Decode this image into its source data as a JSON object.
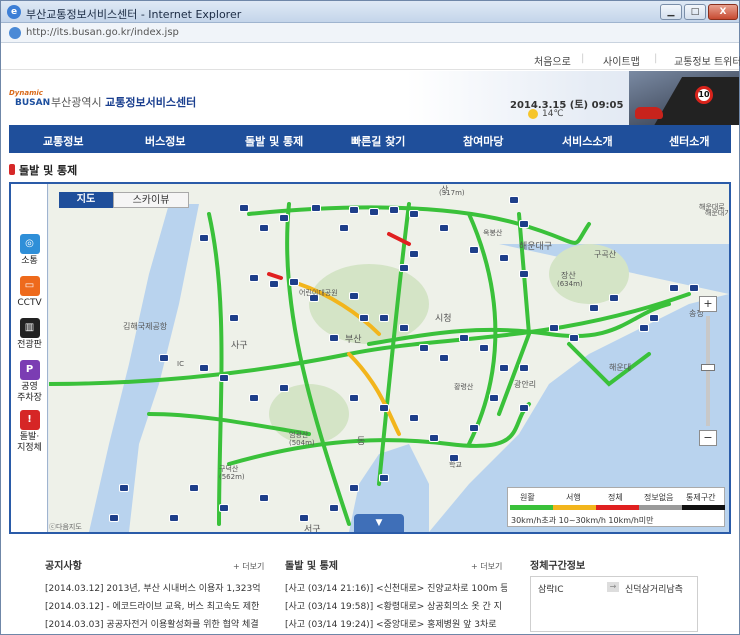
{
  "window": {
    "title": "부산교통정보서비스센터 - Internet Explorer",
    "url": "http://its.busan.go.kr/index.jsp",
    "min_label": "▁",
    "max_label": "□",
    "close_label": "X"
  },
  "topnav": {
    "home": "처음으로",
    "sitemap": "사이트맵",
    "twitter": "교통정보 트위터"
  },
  "header": {
    "logo_top": "Dynamic",
    "logo_bottom": "BUSAN",
    "city": "부산광역시",
    "center": "교통정보서비스센터",
    "datetime": "2014.3.15 (토) 09:05",
    "temperature": "14℃",
    "speed_sign": "10"
  },
  "mainnav": [
    "교통정보",
    "버스정보",
    "돌발 및 통제",
    "빠른길 찾기",
    "참여마당",
    "서비스소개",
    "센터소개"
  ],
  "section_title": "돌발 및 통제",
  "side_menu": [
    {
      "label": "소통",
      "color": "#2f8fd8",
      "icon": "traffic-icon"
    },
    {
      "label": "CCTV",
      "color": "#ee6a1c",
      "icon": "cctv-icon"
    },
    {
      "label": "전광판",
      "color": "#222222",
      "icon": "sign-board-icon"
    },
    {
      "label": "공영\n주차장",
      "color": "#7b3db3",
      "icon": "parking-icon"
    },
    {
      "label": "돌발·\n지정체",
      "color": "#d62626",
      "icon": "incident-icon"
    }
  ],
  "map": {
    "tab_map": "지도",
    "tab_skyview": "스카이뷰",
    "zoom_in": "+",
    "zoom_out": "−",
    "collapse": "▼",
    "copyright": "ⓒ다음지도",
    "labels": [
      {
        "text": "해운대구",
        "size": 9
      },
      {
        "text": "구곡산",
        "size": 8
      },
      {
        "text": "장산",
        "size": 8
      },
      {
        "text": "(634m)",
        "size": 7
      },
      {
        "text": "해운대",
        "size": 8
      },
      {
        "text": "어린이대공원",
        "size": 7
      },
      {
        "text": "부산",
        "size": 9
      },
      {
        "text": "시청",
        "size": 9
      },
      {
        "text": "김해국제공항",
        "size": 8
      },
      {
        "text": "사구",
        "size": 9
      },
      {
        "text": "엄광산",
        "size": 7
      },
      {
        "text": "(504m)",
        "size": 7
      },
      {
        "text": "구덕산",
        "size": 7
      },
      {
        "text": "(562m)",
        "size": 7
      },
      {
        "text": "광안리",
        "size": 8
      },
      {
        "text": "황령산",
        "size": 7
      },
      {
        "text": "동",
        "size": 9
      },
      {
        "text": "학교",
        "size": 7
      },
      {
        "text": "서구",
        "size": 9
      },
      {
        "text": "해운대로",
        "size": 7
      },
      {
        "text": "옥봉산",
        "size": 7
      },
      {
        "text": "산",
        "size": 8
      },
      {
        "text": "(317m)",
        "size": 7
      },
      {
        "text": "송정",
        "size": 8
      },
      {
        "text": "해운대기업",
        "size": 7
      },
      {
        "text": "IC",
        "size": 7
      }
    ],
    "legend": {
      "items": [
        {
          "label": "원활",
          "color": "#3ac13a"
        },
        {
          "label": "서행",
          "color": "#f2b51c"
        },
        {
          "label": "정체",
          "color": "#e02020"
        },
        {
          "label": "정보없음",
          "color": "#9a9a9a"
        },
        {
          "label": "통제구간",
          "color": "#111111"
        }
      ],
      "ranges": "30km/h초과 10~30km/h 10km/h미만"
    }
  },
  "notices": {
    "title": "공지사항",
    "more": "+ 더보기",
    "items": [
      "[2014.03.12] 2013년, 부산 시내버스 이용자 1,323억 운",
      "[2014.03.12] - 에코드라이브 교육, 버스 최고속도 제한",
      "[2014.03.03] 공공자전거 이용활성화를 위한 협약 체결"
    ]
  },
  "incidents": {
    "title": "돌발 및 통제",
    "more": "+ 더보기",
    "items": [
      "[사고 (03/14 21:16)] <신천대로> 진양교차로 100m 등",
      "[사고 (03/14 19:58)] <황령대로> 상공회의소 옷 간 지",
      "[사고 (03/14 19:24)] <중앙대로> 홍제병원 앞 3차로"
    ]
  },
  "congestion": {
    "title": "정체구간정보",
    "from": "삼락IC",
    "arrow": "→",
    "to": "신덕삼거리남측"
  }
}
